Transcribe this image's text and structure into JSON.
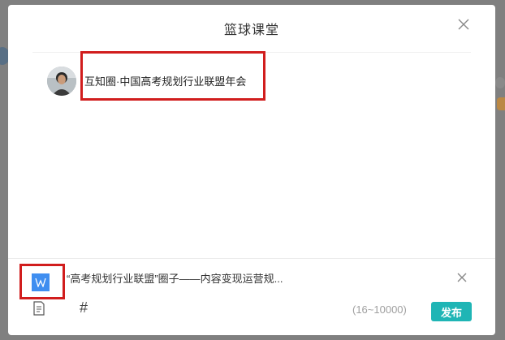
{
  "dialog": {
    "title": "篮球课堂"
  },
  "post": {
    "author_name": "互知圈·中国高考规划行业联盟年会"
  },
  "attachment": {
    "text": "“高考规划行业联盟”圈子——内容变现运营规...",
    "icon": "word-document-icon"
  },
  "toolbar": {
    "doc_icon": "document-icon",
    "hash_label": "#",
    "char_count": "(16~10000)",
    "publish_label": "发布"
  },
  "colors": {
    "publish_bg": "#1fb5b5",
    "attach_icon_bg": "#3f8ef0",
    "highlight_border": "#d11d1d"
  }
}
